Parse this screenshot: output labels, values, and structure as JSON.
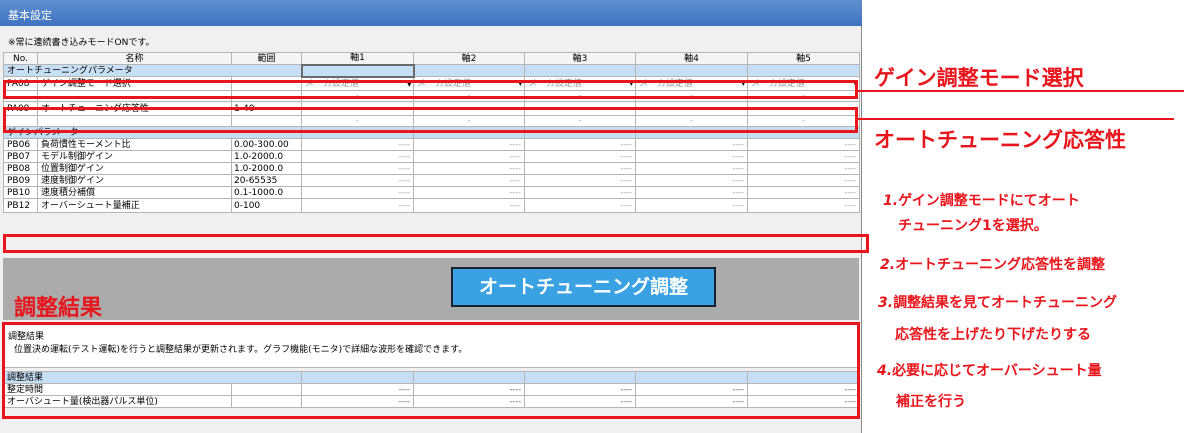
{
  "window": {
    "title": "基本設定",
    "notice": "※常に連続書き込みモードONです。"
  },
  "table": {
    "headers": [
      "No.",
      "名称",
      "範囲",
      "軸1",
      "軸2",
      "軸3",
      "軸4",
      "軸5"
    ],
    "section_auto": "オートチューニングパラメータ",
    "section_gain": "ゲインパラメータ",
    "dropdown_value": "メーカ設定値",
    "empty_value": "----",
    "small_value": "-",
    "rows_auto": [
      {
        "no": "PA08",
        "name": "ゲイン調整モード選択",
        "range": ""
      },
      {
        "no": "PA09",
        "name": "オートチューニング応答性",
        "range": "1-40"
      }
    ],
    "rows_gain": [
      {
        "no": "PB06",
        "name": "負荷慣性モーメント比",
        "range": "0.00-300.00"
      },
      {
        "no": "PB07",
        "name": "モデル制御ゲイン",
        "range": "1.0-2000.0"
      },
      {
        "no": "PB08",
        "name": "位置制御ゲイン",
        "range": "1.0-2000.0"
      },
      {
        "no": "PB09",
        "name": "速度制御ゲイン",
        "range": "20-65535"
      },
      {
        "no": "PB10",
        "name": "速度積分補償",
        "range": "0.1-1000.0"
      },
      {
        "no": "PB12",
        "name": "オーバーシュート量補正",
        "range": "0-100"
      }
    ]
  },
  "auto_tune_button": "オートチューニング調整",
  "result_label": "調整結果",
  "result_panel": {
    "title": "調整結果",
    "desc": "位置決め運転(テスト運転)を行うと調整結果が更新されます。グラフ機能(モニタ)で詳細な波形を確認できます。"
  },
  "result_table": {
    "header": "調整結果",
    "rows": [
      {
        "name": "整定時間",
        "value": "----"
      },
      {
        "name": "オーバシュート量(検出器パルス単位)",
        "value": "----"
      }
    ]
  },
  "annotations": {
    "gain_mode": "ゲイン調整モード選択",
    "response": "オートチューニング応答性",
    "steps": [
      {
        "num": "1.",
        "line1": "ゲイン調整モードにてオート",
        "line2": "チューニング1を選択。"
      },
      {
        "num": "2.",
        "line1": "オートチューニング応答性を調整"
      },
      {
        "num": "3.",
        "line1": "調整結果を見てオートチューニング",
        "line2": "応答性を上げたり下げたりする"
      },
      {
        "num": "4.",
        "line1": "必要に応じてオーバーシュート量",
        "line2": "補正を行う"
      }
    ]
  },
  "colors": {
    "accent_red": "#e8151c",
    "button_blue": "#3aa2e3",
    "section_blue": "#c7dff4"
  }
}
